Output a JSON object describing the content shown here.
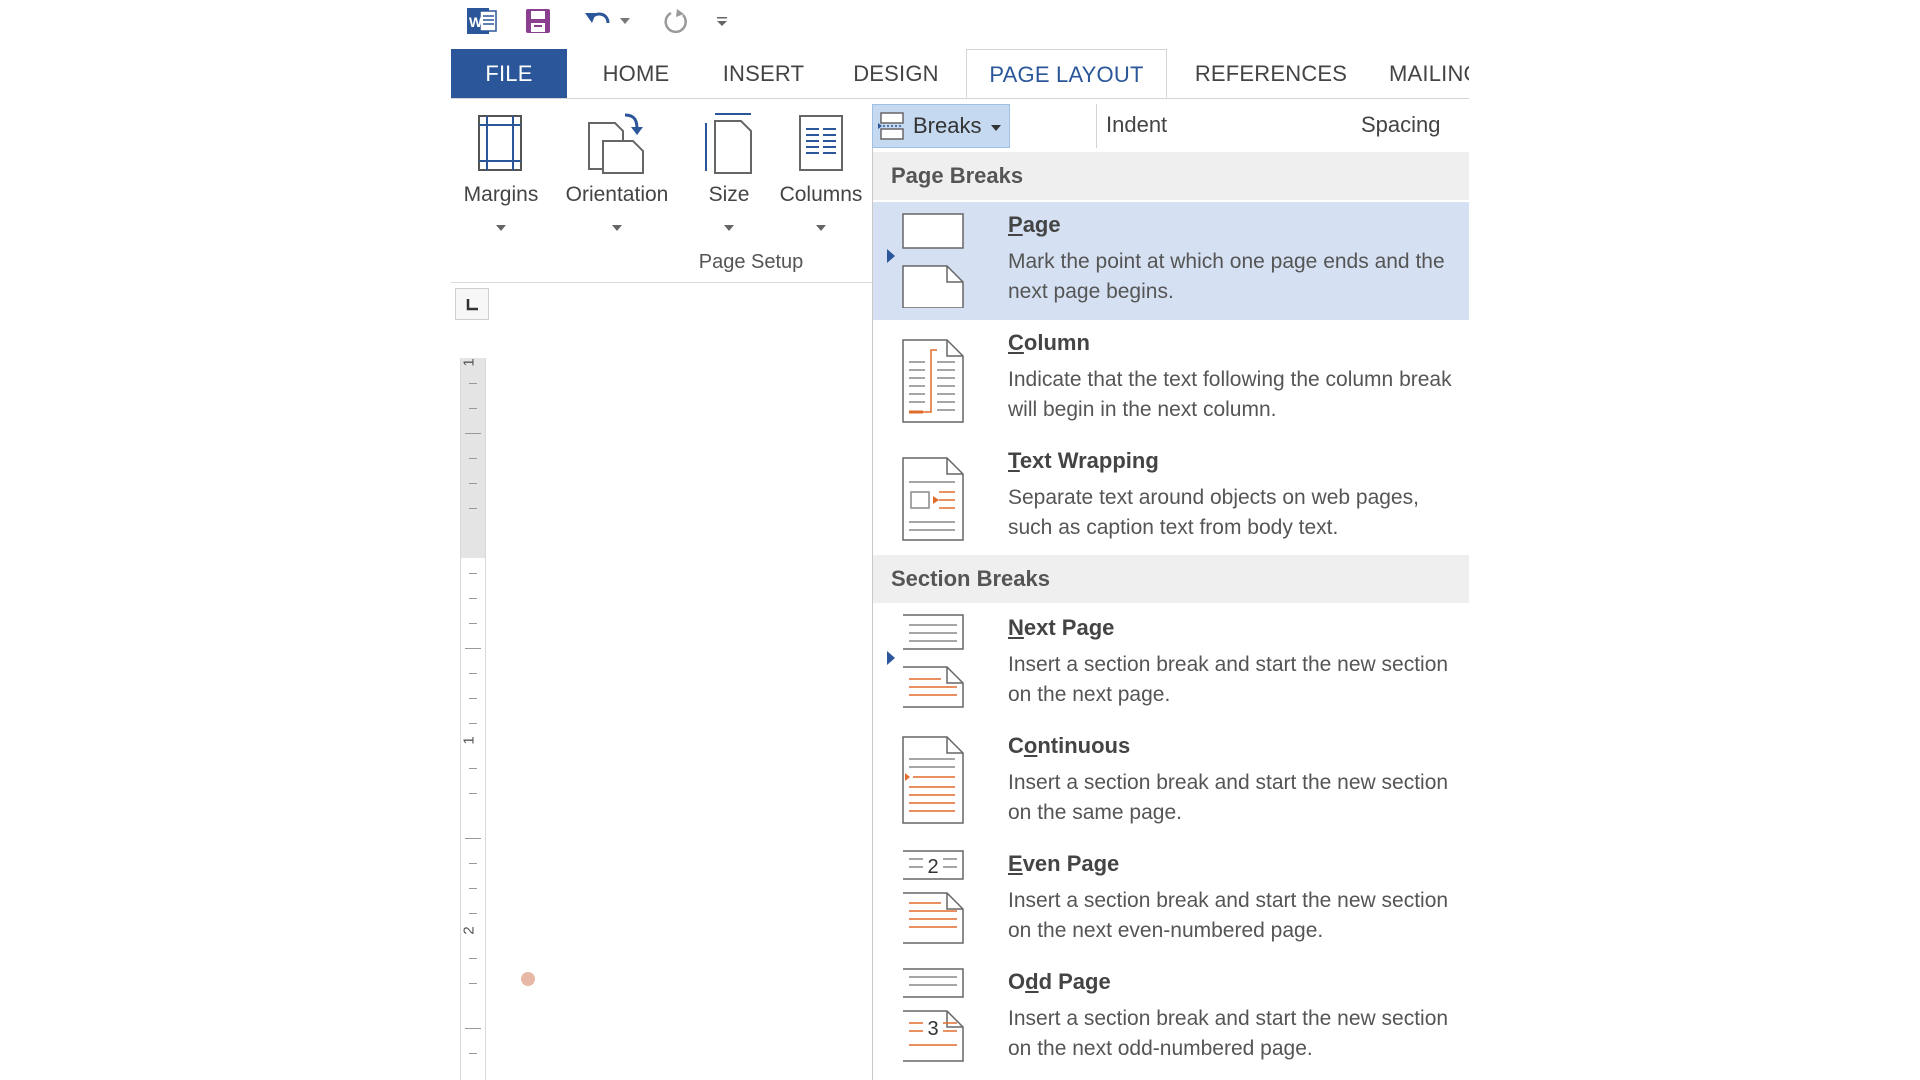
{
  "colors": {
    "file_tab": "#2b579a",
    "accent": "#2b579a",
    "selected_item": "#d5e1f2",
    "orange": "#e06c2c"
  },
  "quick_access": {
    "icons": [
      "word-icon",
      "save-icon",
      "undo-icon",
      "undo-dropdown-icon",
      "redo-icon",
      "customize-qat-icon"
    ]
  },
  "tabs": [
    {
      "label": "FILE"
    },
    {
      "label": "HOME"
    },
    {
      "label": "INSERT"
    },
    {
      "label": "DESIGN"
    },
    {
      "label": "PAGE LAYOUT"
    },
    {
      "label": "REFERENCES"
    },
    {
      "label": "MAILINGS"
    }
  ],
  "ribbon": {
    "margins": "Margins",
    "orientation": "Orientation",
    "size": "Size",
    "columns": "Columns",
    "group_label": "Page Setup",
    "breaks": "Breaks",
    "indent": "Indent",
    "spacing": "Spacing"
  },
  "ruler": {
    "numbers": [
      "1",
      "1",
      "2"
    ]
  },
  "breaks_menu": {
    "page_breaks_header": "Page Breaks",
    "section_breaks_header": "Section Breaks",
    "items": [
      {
        "key": "P",
        "rest": "age",
        "desc": "Mark the point at which one page ends and the next page begins."
      },
      {
        "key": "C",
        "rest": "olumn",
        "desc": "Indicate that the text following the column break will begin in the next column."
      },
      {
        "key": "T",
        "rest": "ext Wrapping",
        "desc": "Separate text around objects on web pages, such as caption text from body text."
      },
      {
        "key": "N",
        "rest": "ext Page",
        "desc": "Insert a section break and start the new section on the next page."
      },
      {
        "pre": "C",
        "key": "o",
        "rest": "ntinuous",
        "desc": "Insert a section break and start the new section on the same page."
      },
      {
        "key": "E",
        "rest": "ven Page",
        "desc": "Insert a section break and start the new section on the next even-numbered page."
      },
      {
        "pre": "O",
        "key": "d",
        "rest": "d Page",
        "desc": "Insert a section break and start the new section on the next odd-numbered page."
      }
    ],
    "even_icon_number": "2",
    "odd_icon_number": "3"
  }
}
